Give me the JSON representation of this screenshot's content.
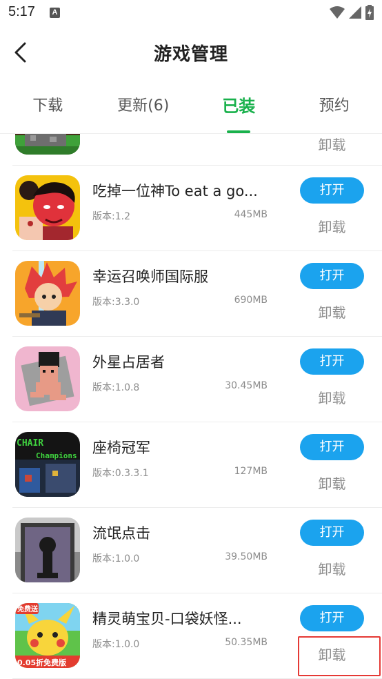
{
  "status_bar": {
    "time": "5:17",
    "notification_letter": "A"
  },
  "header": {
    "title": "游戏管理"
  },
  "tabs": [
    {
      "label": "下载"
    },
    {
      "label": "更新(6)"
    },
    {
      "label": "已装"
    },
    {
      "label": "预约"
    }
  ],
  "actions": {
    "open_label": "打开",
    "uninstall_label": "卸载"
  },
  "games": [
    {
      "name": "吃掉一位神To eat a go...",
      "version": "版本:1.2",
      "size": "445MB"
    },
    {
      "name": "幸运召唤师国际服",
      "version": "版本:3.3.0",
      "size": "690MB"
    },
    {
      "name": "外星占居者",
      "version": "版本:1.0.8",
      "size": "30.45MB"
    },
    {
      "name": "座椅冠军",
      "version": "版本:0.3.3.1",
      "size": "127MB"
    },
    {
      "name": "流氓点击",
      "version": "版本:1.0.0",
      "size": "39.50MB"
    },
    {
      "name": "精灵萌宝贝-口袋妖怪...",
      "version": "版本:1.0.0",
      "size": "50.35MB"
    }
  ],
  "icon_text": {
    "chair_top": "CHAIR",
    "chair_sub": "Champions",
    "pika_badge": "免费送",
    "pika_banner": "0.05折免费版"
  },
  "colors": {
    "accent_green": "#19b14c",
    "button_blue": "#1ba3ee",
    "highlight_red": "#e53935"
  }
}
